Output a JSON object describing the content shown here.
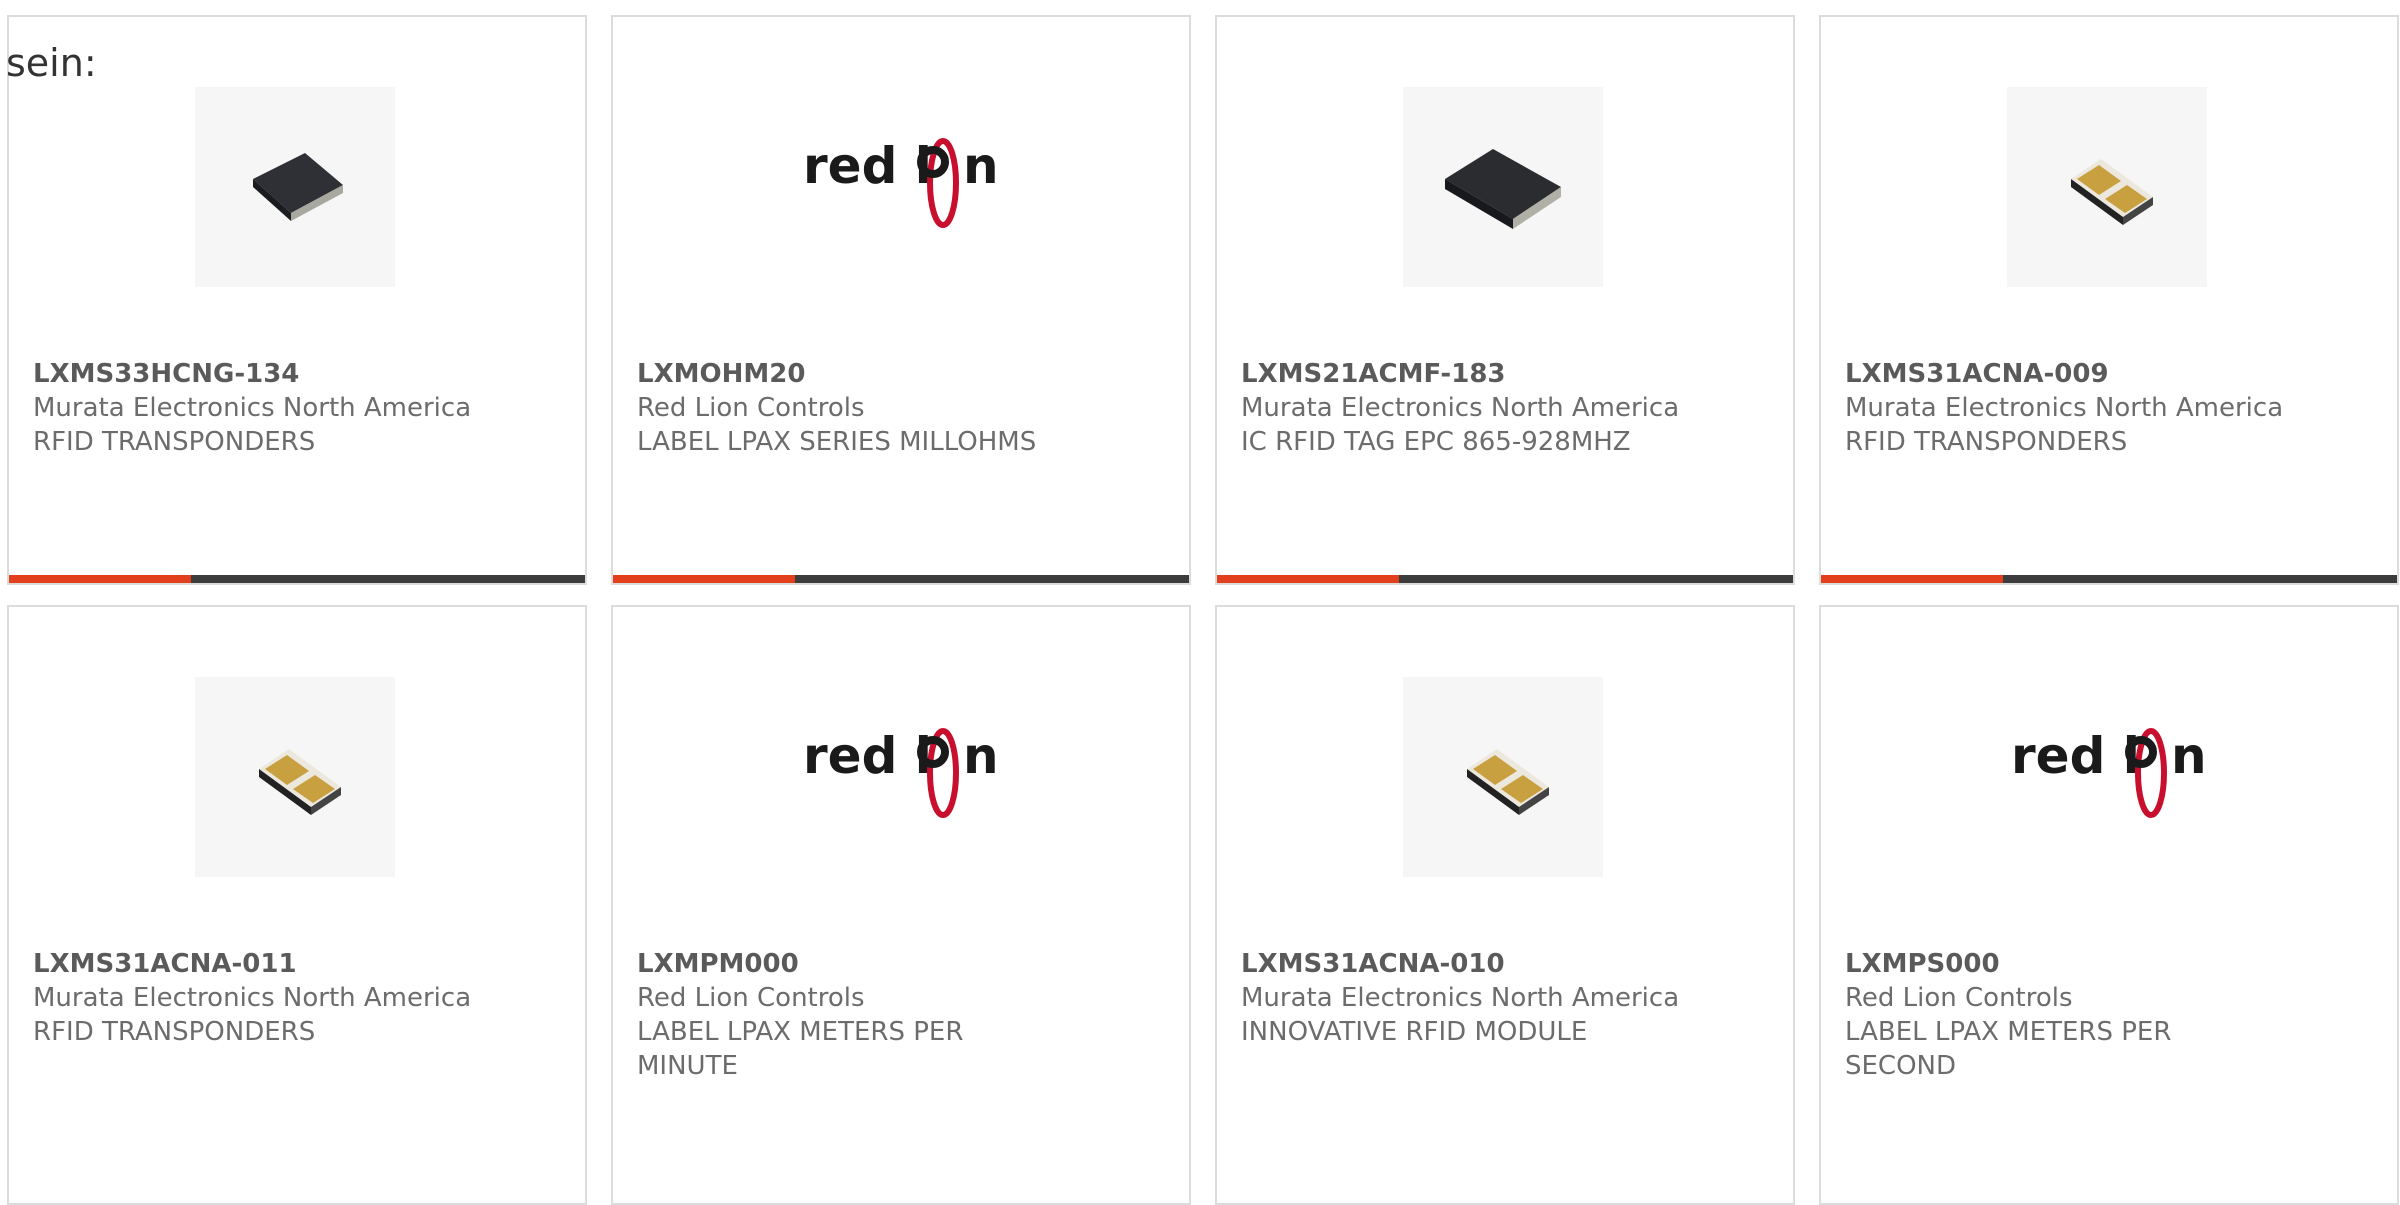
{
  "intro_text": "sein:",
  "accent_color": "#e2401c",
  "products": [
    {
      "part": "LXMS33HCNG-134",
      "maker": "Murata Electronics North America",
      "desc": [
        "RFID TRANSPONDERS"
      ],
      "image": "dark-chip-square-icon"
    },
    {
      "part": "LXMOHM20",
      "maker": "Red Lion Controls",
      "desc": [
        "LABEL LPAX SERIES MILLOHMS"
      ],
      "image": "red-lion-logo"
    },
    {
      "part": "LXMS21ACMF-183",
      "maker": "Murata Electronics North America",
      "desc": [
        "IC RFID TAG EPC 865-928MHZ"
      ],
      "image": "dark-chip-rect-icon"
    },
    {
      "part": "LXMS31ACNA-009",
      "maker": "Murata Electronics North America",
      "desc": [
        "RFID TRANSPONDERS"
      ],
      "image": "gold-pad-chip-icon"
    },
    {
      "part": "LXMS31ACNA-011",
      "maker": "Murata Electronics North America",
      "desc": [
        "RFID TRANSPONDERS"
      ],
      "image": "gold-pad-chip-icon"
    },
    {
      "part": "LXMPM000",
      "maker": "Red Lion Controls",
      "desc": [
        "LABEL LPAX METERS PER",
        "MINUTE"
      ],
      "image": "red-lion-logo"
    },
    {
      "part": "LXMS31ACNA-010",
      "maker": "Murata Electronics North America",
      "desc": [
        "INNOVATIVE RFID MODULE"
      ],
      "image": "gold-pad-chip-icon"
    },
    {
      "part": "LXMPS000",
      "maker": "Red Lion Controls",
      "desc": [
        "LABEL LPAX METERS PER",
        "SECOND"
      ],
      "image": "red-lion-logo"
    }
  ],
  "brand_logo_text": "red lion"
}
